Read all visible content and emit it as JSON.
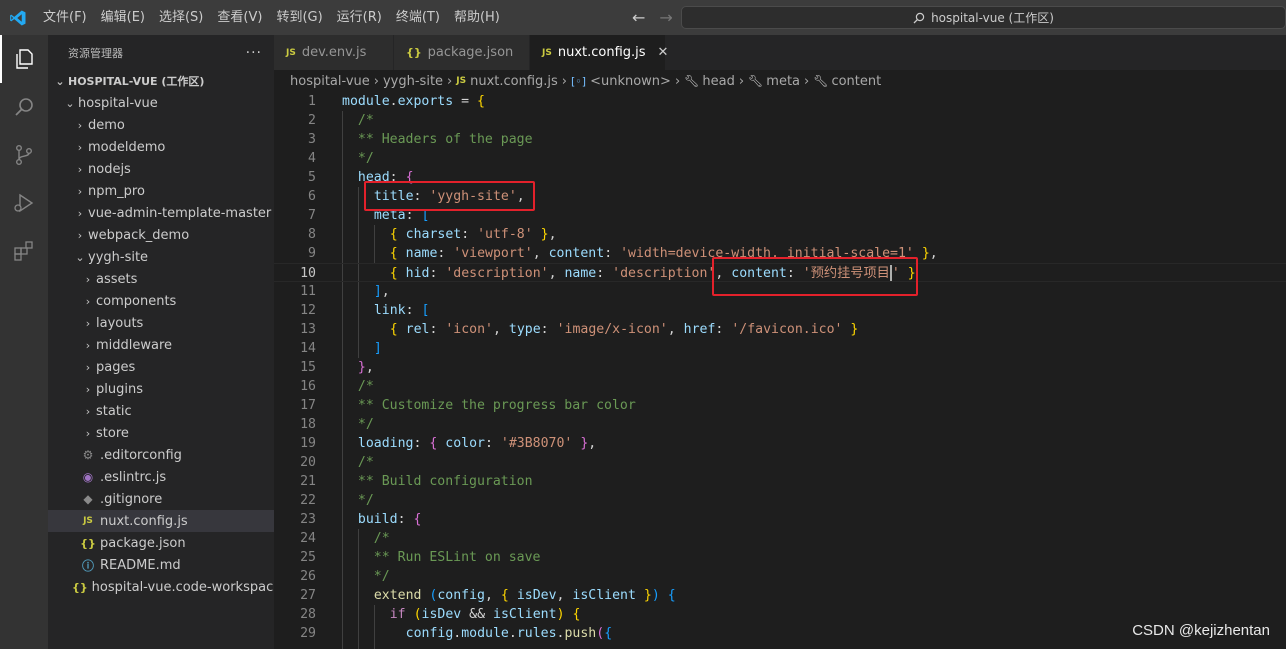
{
  "window": {
    "search_label": "hospital-vue (工作区)",
    "menu": [
      "文件(F)",
      "编辑(E)",
      "选择(S)",
      "查看(V)",
      "转到(G)",
      "运行(R)",
      "终端(T)",
      "帮助(H)"
    ]
  },
  "sidebar": {
    "title": "资源管理器",
    "more": "···",
    "workspace": "HOSPITAL-VUE (工作区)",
    "root_folder": "hospital-vue",
    "folders": [
      "demo",
      "modeldemo",
      "nodejs",
      "npm_pro",
      "vue-admin-template-master",
      "webpack_demo"
    ],
    "open_folder": "yygh-site",
    "subfolders": [
      "assets",
      "components",
      "layouts",
      "middleware",
      "pages",
      "plugins",
      "static",
      "store"
    ],
    "files": [
      ".editorconfig",
      ".eslintrc.js",
      ".gitignore",
      "nuxt.config.js",
      "package.json",
      "README.md"
    ],
    "workspace_file": "hospital-vue.code-workspace"
  },
  "tabs": [
    {
      "label": "dev.env.js",
      "icon": "JS",
      "active": false
    },
    {
      "label": "package.json",
      "icon": "{}",
      "active": false
    },
    {
      "label": "nuxt.config.js",
      "icon": "JS",
      "active": true
    }
  ],
  "breadcrumb": [
    "hospital-vue",
    "yygh-site",
    "nuxt.config.js",
    "<unknown>",
    "head",
    "meta",
    "content"
  ],
  "editor": {
    "current_line": 10,
    "lines": [
      "module.exports = {",
      "  /*",
      "  ** Headers of the page",
      "  */",
      "  head: {",
      "    title: 'yygh-site',",
      "    meta: [",
      "      { charset: 'utf-8' },",
      "      { name: 'viewport', content: 'width=device-width, initial-scale=1' },",
      "      { hid: 'description', name: 'description', content: '预约挂号项目' }",
      "    ],",
      "    link: [",
      "      { rel: 'icon', type: 'image/x-icon', href: '/favicon.ico' }",
      "    ]",
      "  },",
      "  /*",
      "  ** Customize the progress bar color",
      "  */",
      "  loading: { color: '#3B8070' },",
      "  /*",
      "  ** Build configuration",
      "  */",
      "  build: {",
      "    /*",
      "    ** Run ESLint on save",
      "    */",
      "    extend (config, { isDev, isClient }) {",
      "      if (isDev && isClient) {",
      "        config.module.rules.push({"
    ]
  },
  "watermark": "CSDN @kejizhentan"
}
